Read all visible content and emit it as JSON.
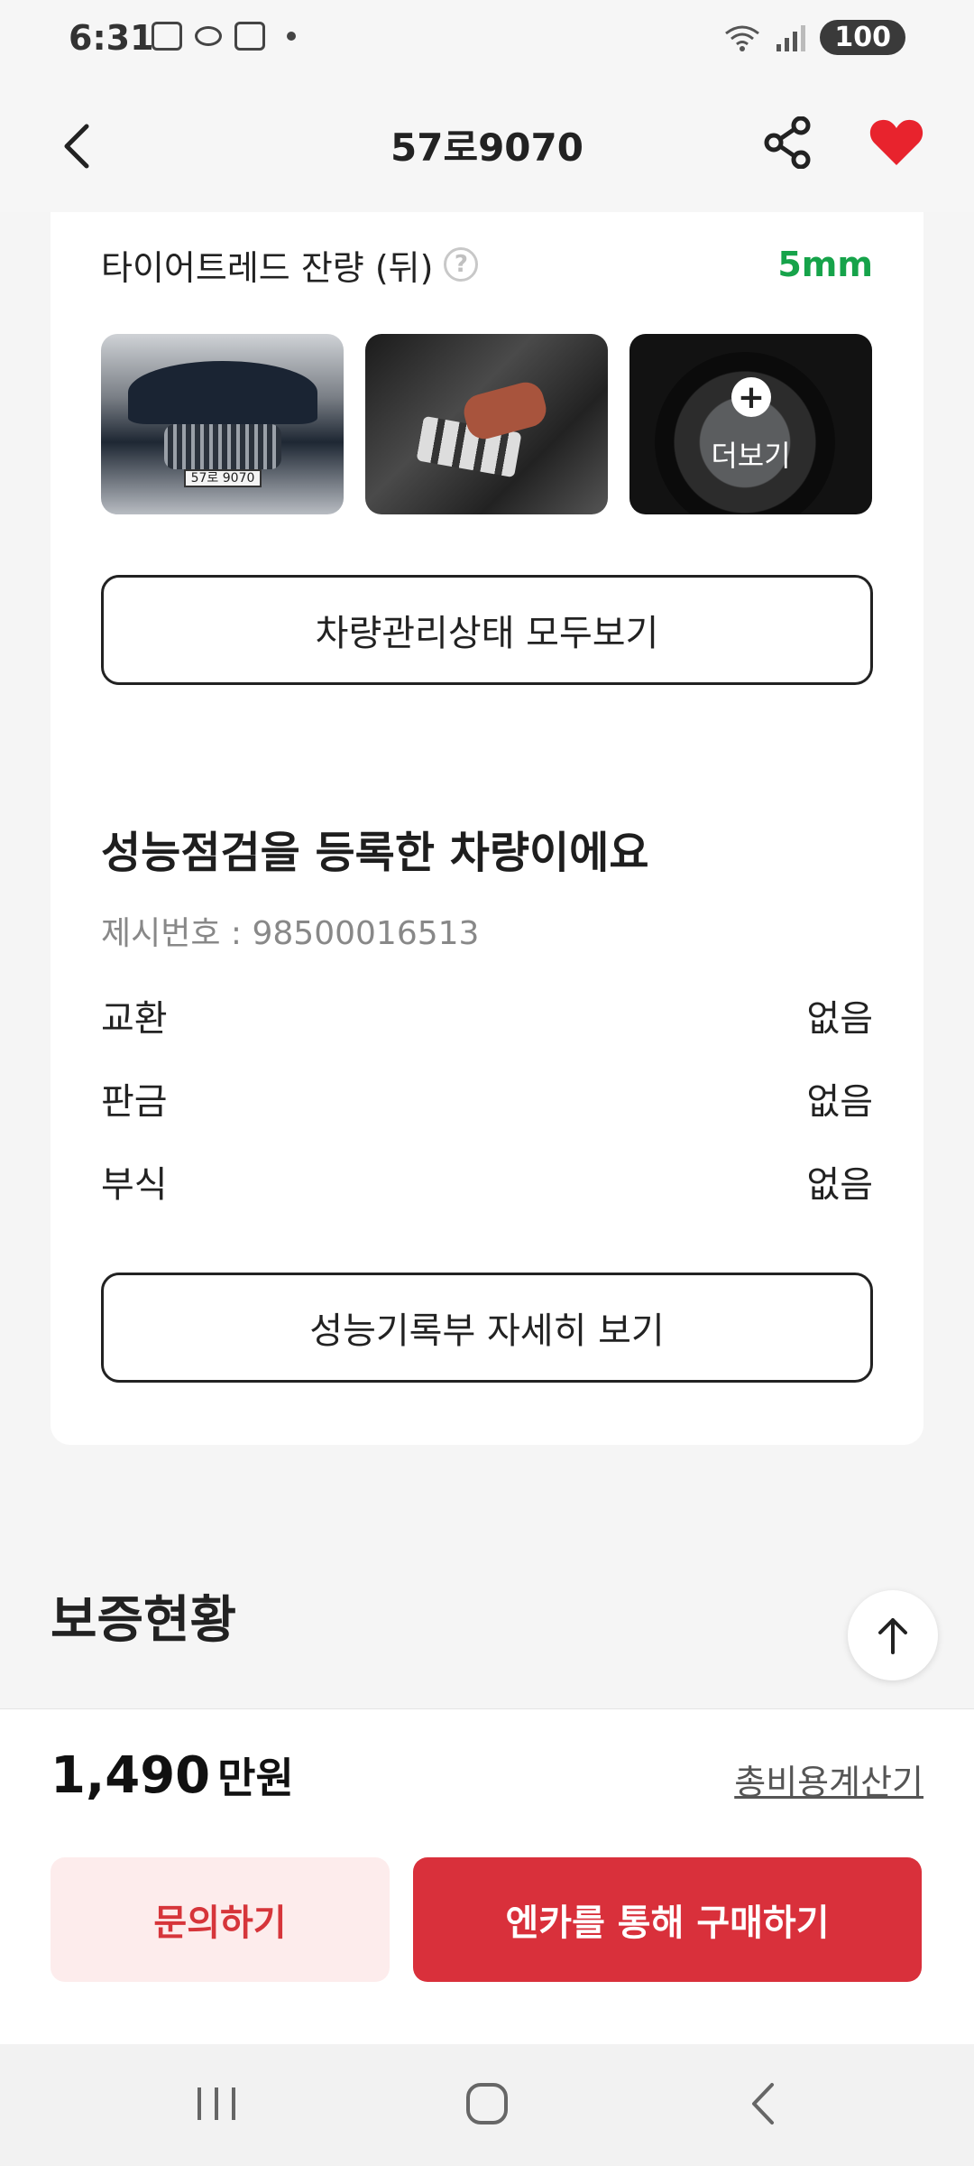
{
  "status_bar": {
    "time": "6:31",
    "battery": "100"
  },
  "app_bar": {
    "title": "57로9070"
  },
  "tread": {
    "label": "타이어트레드 잔량 (뒤)",
    "help": "?",
    "value": "5mm"
  },
  "photos": {
    "more_label": "더보기",
    "more_plus": "+",
    "plate_text": "57로 9070"
  },
  "buttons": {
    "view_all_management": "차량관리상태 모두보기",
    "view_performance_details": "성능기록부 자세히 보기"
  },
  "performance": {
    "title": "성능점검을 등록한 차량이에요",
    "listing_number": "제시번호 : 98500016513",
    "rows": [
      {
        "label": "교환",
        "value": "없음"
      },
      {
        "label": "판금",
        "value": "없음"
      },
      {
        "label": "부식",
        "value": "없음"
      }
    ]
  },
  "warranty": {
    "title": "보증현황"
  },
  "bottom": {
    "price_number": "1,490",
    "price_unit": "만원",
    "calculator_link": "총비용계산기",
    "inquiry_button": "문의하기",
    "buy_button": "엔카를 통해 구매하기"
  },
  "colors": {
    "accent_red": "#d9303b",
    "tread_green": "#16a34a",
    "inquiry_bg": "#fdecec"
  }
}
